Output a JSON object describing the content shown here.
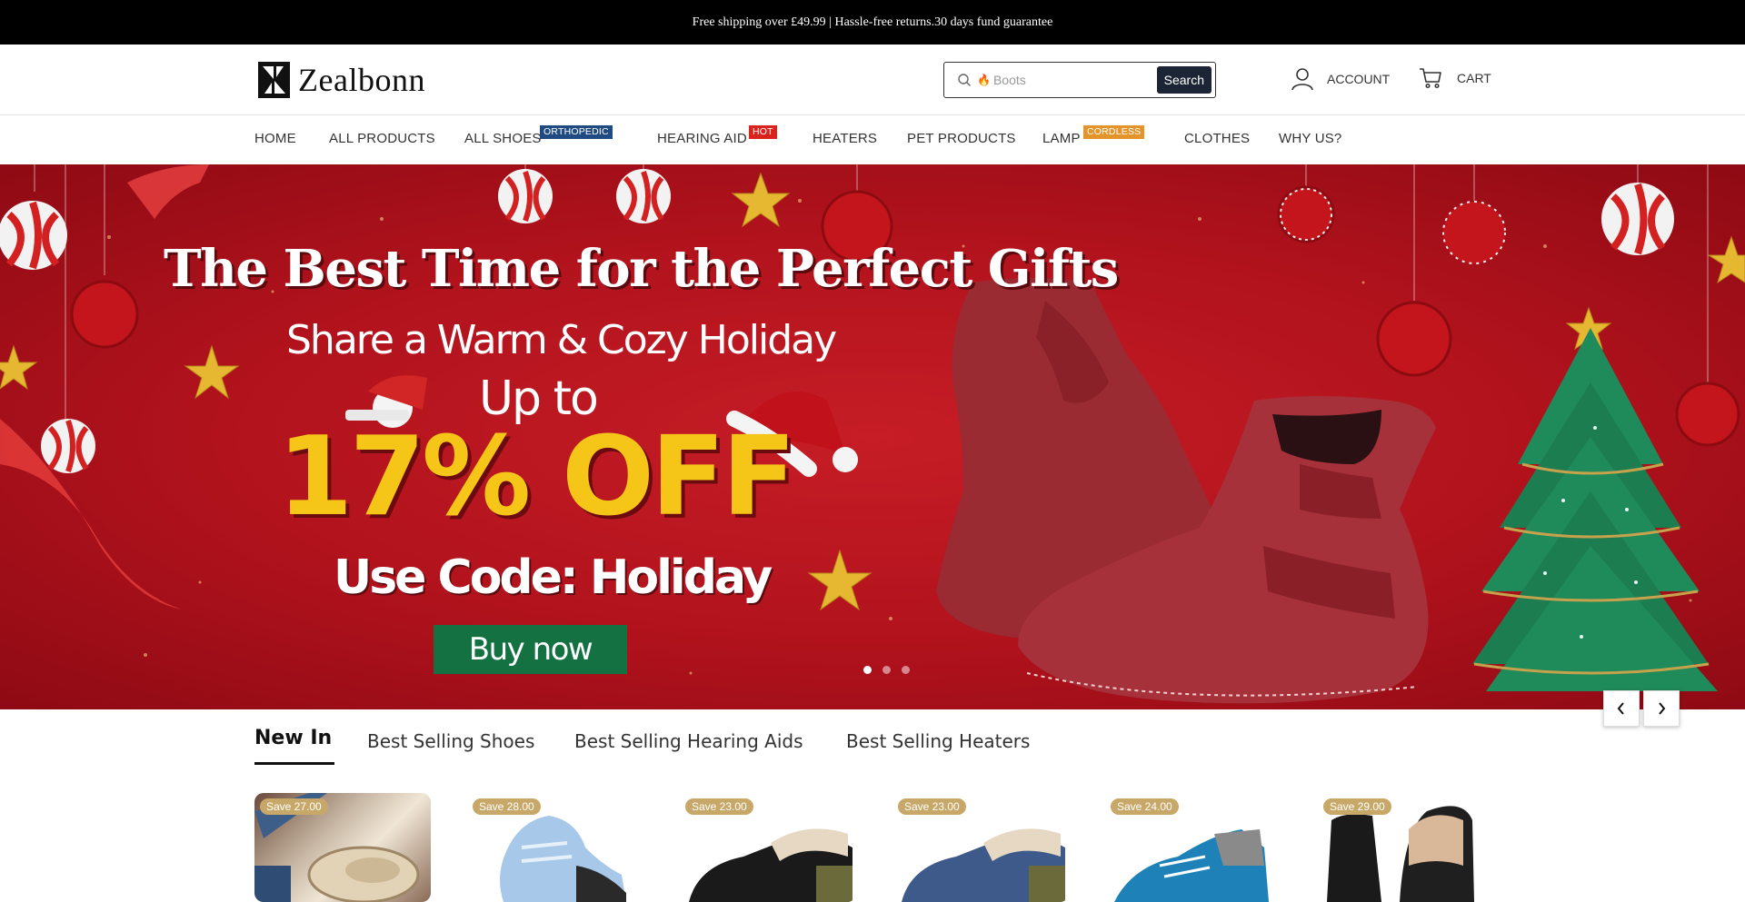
{
  "announcement": "Free shipping over £49.99 | Hassle-free returns.30 days fund guarantee",
  "header": {
    "logo_text": "Zealbonn",
    "search": {
      "value": "Boots",
      "button_label": "Search"
    },
    "account_label": "ACCOUNT",
    "cart_label": "CART"
  },
  "nav": {
    "items": [
      {
        "label": "HOME"
      },
      {
        "label": "ALL PRODUCTS"
      },
      {
        "label": "ALL SHOES",
        "badge": "ORTHOPEDIC",
        "badge_color": "#1f4b82"
      },
      {
        "label": "HEARING AID",
        "badge": "HOT",
        "badge_color": "#d9231c"
      },
      {
        "label": "HEATERS"
      },
      {
        "label": "PET PRODUCTS"
      },
      {
        "label": "LAMP",
        "badge": "CORDLESS",
        "badge_color": "#e3952c"
      },
      {
        "label": "CLOTHES"
      },
      {
        "label": "WHY US?"
      }
    ]
  },
  "hero": {
    "headline": "The Best Time for the Perfect Gifts",
    "subheadline": "Share a Warm & Cozy Holiday",
    "up_to": "Up to",
    "discount": "17% OFF",
    "code": "Use Code: Holiday",
    "cta": "Buy now",
    "colors": {
      "background": "#b8151f",
      "discount": "#f5c518",
      "cta": "#137142"
    },
    "slides": {
      "count": 3,
      "active_index": 0
    }
  },
  "tabs": {
    "items": [
      "New In",
      "Best Selling Shoes",
      "Best Selling Hearing Aids",
      "Best Selling Heaters"
    ],
    "active": "New In"
  },
  "products": [
    {
      "save": "Save 27.00"
    },
    {
      "save": "Save 28.00"
    },
    {
      "save": "Save 23.00"
    },
    {
      "save": "Save 23.00"
    },
    {
      "save": "Save 24.00"
    },
    {
      "save": "Save 29.00"
    }
  ]
}
